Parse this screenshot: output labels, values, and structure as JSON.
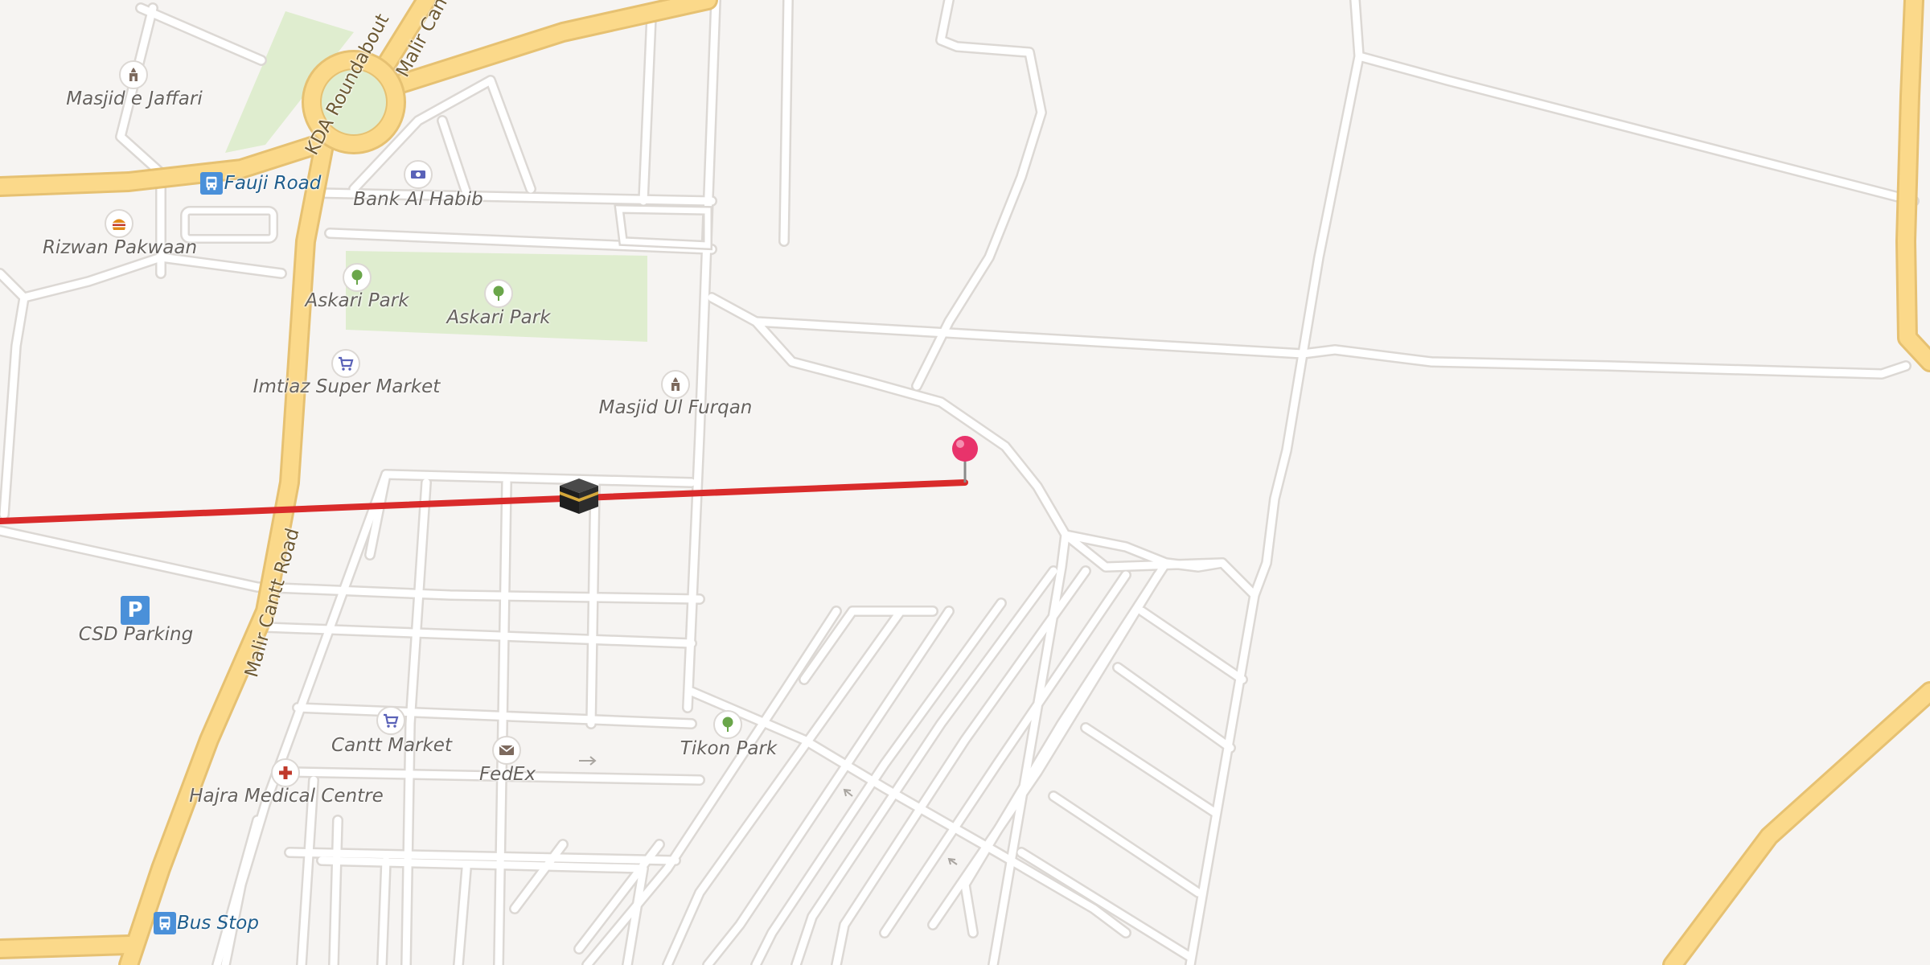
{
  "map": {
    "colors": {
      "land": "#f6f4f2",
      "park": "#dfedcf",
      "major_road": "#fbd98a",
      "major_road_casing": "#e6c172",
      "minor_road": "#ffffff",
      "minor_road_casing": "#dcd8d4",
      "qibla_line": "#d92b2b",
      "pin": "#e8336b"
    },
    "places": [
      {
        "name": "Masjid e Jaffari",
        "icon": "mosque-icon"
      },
      {
        "name": "Bank Al Habib",
        "icon": "bank-icon"
      },
      {
        "name": "Rizwan Pakwaan",
        "icon": "fast-food-icon"
      },
      {
        "name": "Askari Park",
        "icon": "park-tree-icon"
      },
      {
        "name": "Askari Park",
        "icon": "park-tree-icon"
      },
      {
        "name": "Imtiaz Super Market",
        "icon": "shopping-cart-icon"
      },
      {
        "name": "Masjid Ul Furqan",
        "icon": "mosque-icon"
      },
      {
        "name": "CSD Parking",
        "icon": "parking-icon"
      },
      {
        "name": "Cantt Market",
        "icon": "shopping-cart-icon"
      },
      {
        "name": "FedEx",
        "icon": "mail-envelope-icon"
      },
      {
        "name": "Tikon Park",
        "icon": "park-tree-icon"
      },
      {
        "name": "Hajra Medical Centre",
        "icon": "medical-cross-icon"
      }
    ],
    "transit": [
      {
        "name": "Fauji Road",
        "icon": "bus-stop-icon"
      },
      {
        "name": "Bus Stop",
        "icon": "bus-stop-icon"
      }
    ],
    "roads": {
      "roundabout": "KDA Roundabout",
      "malir_cantt": "Malir Cantt Road",
      "malir_cantt_top": "Malir Cant"
    },
    "markers": {
      "kaaba": "kaaba-icon",
      "pin": "location-pin-icon"
    }
  }
}
